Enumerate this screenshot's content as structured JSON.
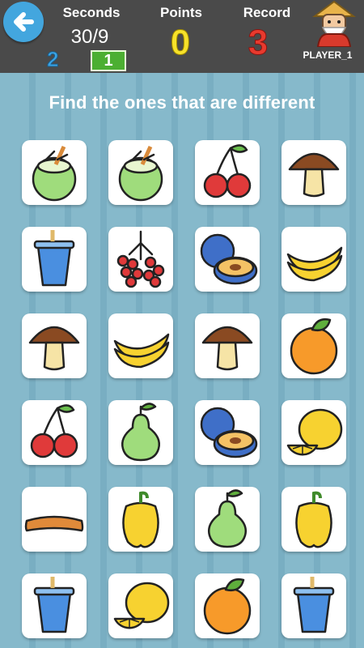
{
  "header": {
    "seconds_label": "Seconds",
    "seconds_value": "30/9",
    "counter_left": "2",
    "counter_badge": "1",
    "points_label": "Points",
    "points_value": "0",
    "record_label": "Record",
    "record_value": "3",
    "player_name": "PLAYER_1"
  },
  "instruction": "Find the ones that are different",
  "grid": [
    [
      "coconut",
      "coconut",
      "cherries",
      "mushroom"
    ],
    [
      "drink",
      "berries",
      "plum",
      "banana"
    ],
    [
      "mushroom",
      "banana",
      "mushroom",
      "orange"
    ],
    [
      "cherries",
      "pear",
      "plum",
      "lemon"
    ],
    [
      "sausage",
      "pepper",
      "pear",
      "pepper"
    ],
    [
      "drink",
      "lemon",
      "orange",
      "drink"
    ]
  ],
  "colors": {
    "topbar": "#4a4a4a",
    "back_button": "#43a6de",
    "background": "#86b9cb",
    "points": "#f7e22a",
    "record": "#e83a2e",
    "counter_left": "#3aa3e6",
    "badge": "#4caf32"
  }
}
